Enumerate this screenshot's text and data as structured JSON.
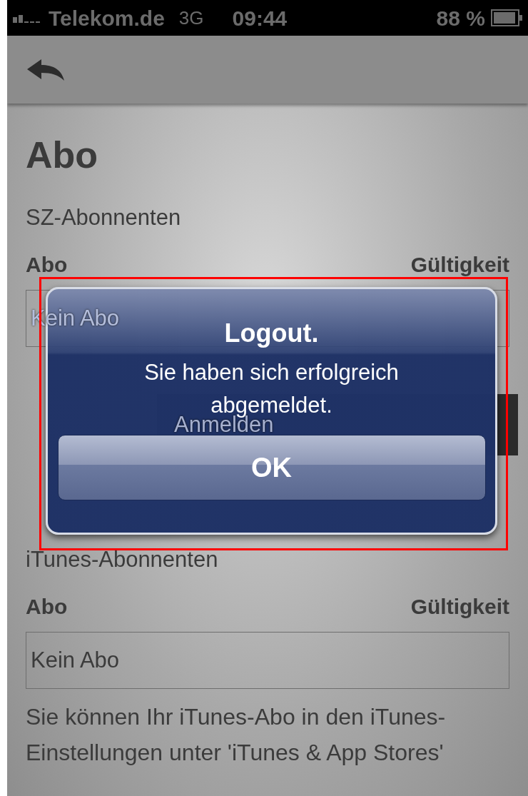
{
  "status_bar": {
    "carrier": "Telekom.de",
    "network": "3G",
    "time": "09:44",
    "battery": "88 %"
  },
  "heading": "Abo",
  "sections": [
    {
      "title": "SZ-Abonnenten",
      "columns": [
        "Abo",
        "Gültigkeit"
      ],
      "value": "Kein Abo",
      "button": "Anmelden"
    },
    {
      "title": "iTunes-Abonnenten",
      "columns": [
        "Abo",
        "Gültigkeit"
      ],
      "value": "Kein Abo"
    }
  ],
  "note": "Sie können Ihr iTunes-Abo in den iTunes-Einstellungen unter 'iTunes & App Stores'",
  "alert": {
    "title": "Logout.",
    "message": "Sie haben sich erfolgreich abgemeldet.",
    "button": "OK"
  }
}
